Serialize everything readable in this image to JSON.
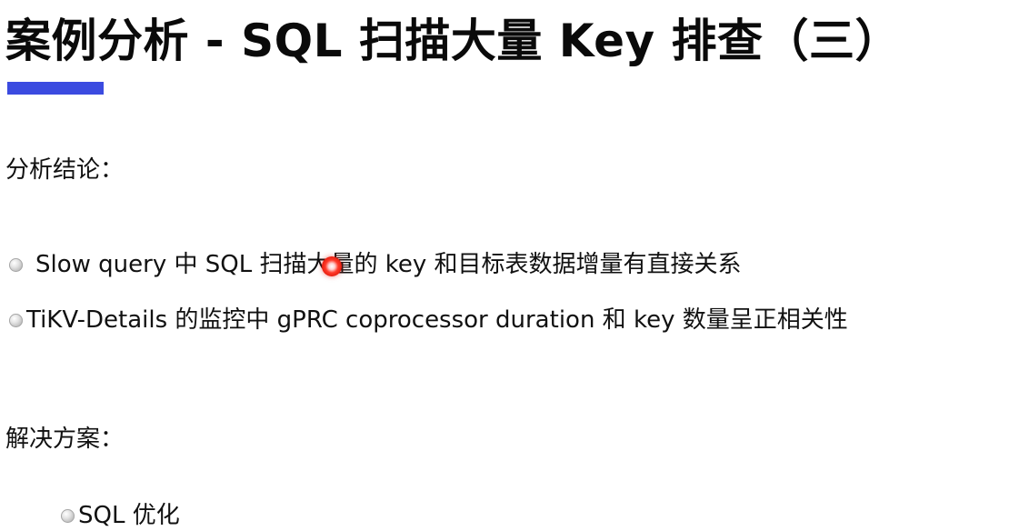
{
  "slide": {
    "title": "案例分析 - SQL 扫描大量 Key 排查（三）",
    "accent_color": "#3b4be0",
    "sections": {
      "analysis": {
        "heading": "分析结论：",
        "bullets": [
          "Slow query 中 SQL 扫描大量的 key 和目标表数据增量有直接关系",
          "TiKV-Details 的监控中 gPRC coprocessor duration 和 key 数量呈正相关性"
        ]
      },
      "solution": {
        "heading": "解决方案：",
        "bullets": [
          "SQL 优化"
        ]
      }
    },
    "bullet_icon": "gray-circle-bullet-icon",
    "pointer": {
      "icon": "red-laser-pointer-icon",
      "color": "#e81f10"
    }
  }
}
